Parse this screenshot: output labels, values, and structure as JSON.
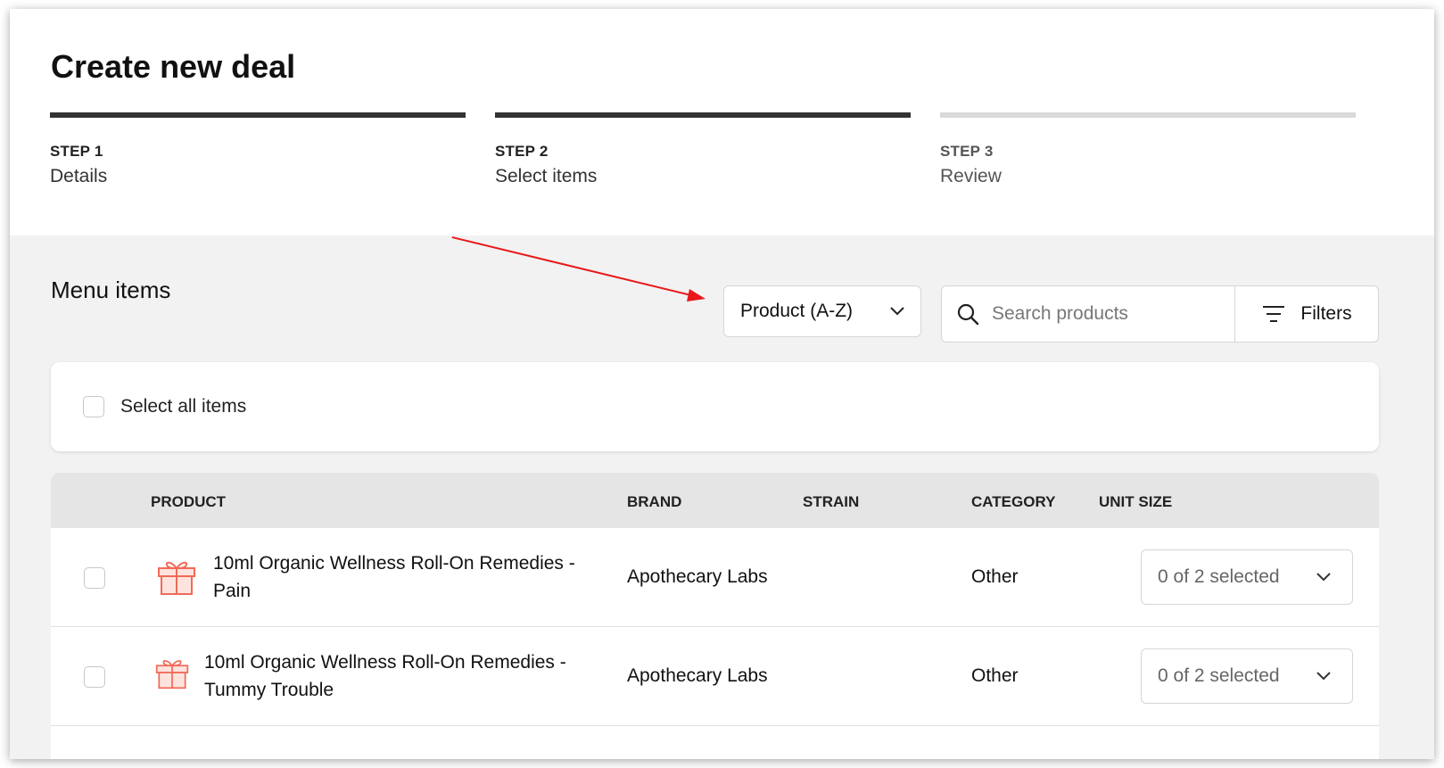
{
  "page": {
    "title": "Create new deal",
    "steps": [
      {
        "num": "STEP 1",
        "label": "Details",
        "state": "complete"
      },
      {
        "num": "STEP 2",
        "label": "Select items",
        "state": "current"
      },
      {
        "num": "STEP 3",
        "label": "Review",
        "state": "upcoming"
      }
    ]
  },
  "menu": {
    "title": "Menu items",
    "sort": {
      "selected": "Product (A-Z)"
    },
    "search": {
      "placeholder": "Search products"
    },
    "filters_label": "Filters",
    "select_all_label": "Select all items"
  },
  "table": {
    "headers": {
      "product": "PRODUCT",
      "brand": "BRAND",
      "strain": "STRAIN",
      "category": "CATEGORY",
      "unit_size": "UNIT SIZE"
    },
    "rows": [
      {
        "product_line1": "10ml Organic Wellness Roll-On Remedies -",
        "product_line2": "Pain",
        "brand": "Apothecary Labs",
        "strain": "",
        "category": "Other",
        "unit_size": "0 of 2 selected",
        "icon": "gift-icon"
      },
      {
        "product_line1": "10ml Organic Wellness Roll-On Remedies -",
        "product_line2": "Tummy Trouble",
        "brand": "Apothecary Labs",
        "strain": "",
        "category": "Other",
        "unit_size": "0 of 2 selected",
        "icon": "gift-icon"
      }
    ]
  },
  "colors": {
    "step_active": "#333333",
    "step_inactive": "#d9d9d9",
    "gift_icon": "#f06a57",
    "annotation_arrow": "#e8191a"
  }
}
